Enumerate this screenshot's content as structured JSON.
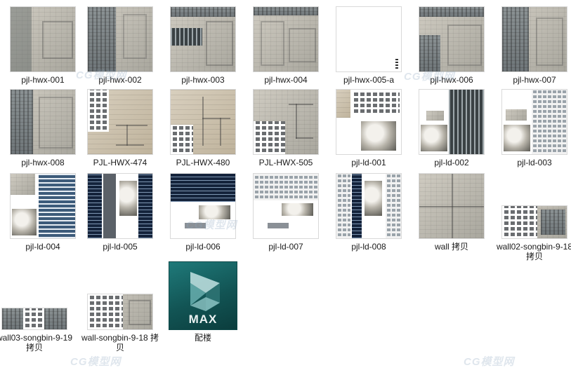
{
  "files": [
    {
      "name": "pjl-hwx-001"
    },
    {
      "name": "pjl-hwx-002"
    },
    {
      "name": "pjl-hwx-003"
    },
    {
      "name": "pjl-hwx-004"
    },
    {
      "name": "pjl-hwx-005-a"
    },
    {
      "name": "pjl-hwx-006"
    },
    {
      "name": "pjl-hwx-007"
    },
    {
      "name": "pjl-hwx-008"
    },
    {
      "name": "PJL-HWX-474"
    },
    {
      "name": "PJL-HWX-480"
    },
    {
      "name": "PJL-HWX-505"
    },
    {
      "name": "pjl-ld-001"
    },
    {
      "name": "pjl-ld-002"
    },
    {
      "name": "pjl-ld-003"
    },
    {
      "name": "pjl-ld-004"
    },
    {
      "name": "pjl-ld-005"
    },
    {
      "name": "pjl-ld-006"
    },
    {
      "name": "pjl-ld-007"
    },
    {
      "name": "pjl-ld-008"
    },
    {
      "name": "wall 拷贝"
    },
    {
      "name": "wall02-songbin-9-18 拷贝"
    },
    {
      "name": "wall03-songbin-9-19 拷贝"
    },
    {
      "name": "wall-songbin-9-18 拷贝"
    },
    {
      "name": "配楼",
      "icon": "3ds-max-icon",
      "icon_text": "MAX"
    }
  ],
  "watermark_text": "CG模型网"
}
